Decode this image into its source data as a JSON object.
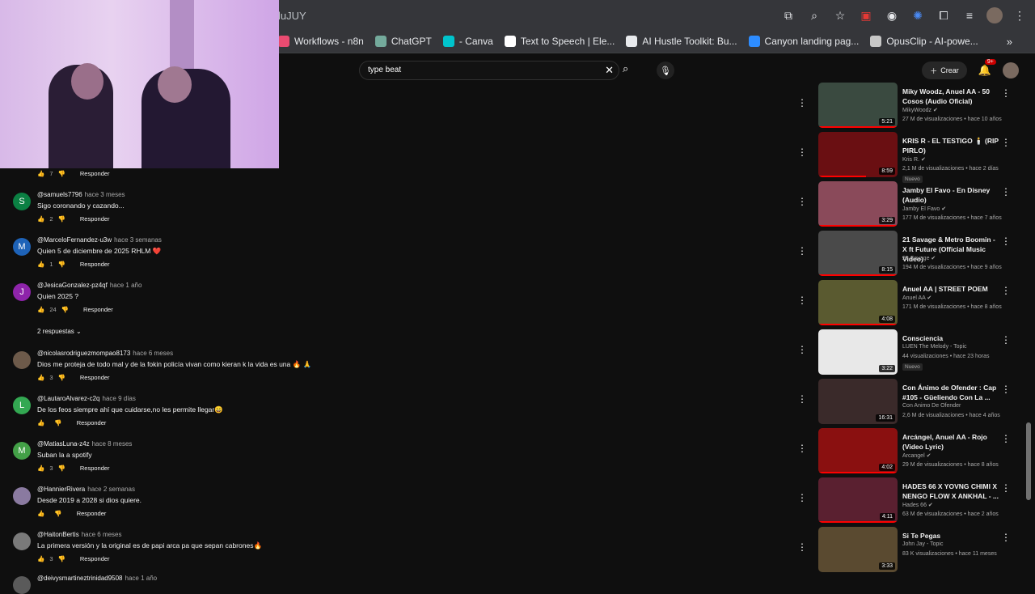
{
  "browser": {
    "url_fragment": "luJUY",
    "icons": [
      "screen-share-icon",
      "zoom-icon",
      "star-icon",
      "pdf-ext-icon",
      "grammarly-ext-icon",
      "ext-icon",
      "puzzle-icon",
      "media-icon",
      "profile-icon"
    ]
  },
  "bookmarks": [
    {
      "label": "Workflows - n8n",
      "color": "#ea4b71"
    },
    {
      "label": "ChatGPT",
      "color": "#74aa9c"
    },
    {
      "label": "- Canva",
      "color": "#00c4cc"
    },
    {
      "label": "Text to Speech | Ele...",
      "color": "#ffffff"
    },
    {
      "label": "AI Hustle Toolkit: Bu...",
      "color": "#e8eaed"
    },
    {
      "label": "Canyon landing pag...",
      "color": "#2d8cff"
    },
    {
      "label": "OpusClip - AI-powe...",
      "color": "#c7c7c7"
    }
  ],
  "bookmarks_more": "»",
  "search": {
    "query": "type beat"
  },
  "header": {
    "create_label": "Crear",
    "notif_count": "9+"
  },
  "comments": [
    {
      "initial": "",
      "user": "",
      "time": "",
      "text": "",
      "likes": "7",
      "reply": "Responder",
      "color": "#555"
    },
    {
      "initial": "S",
      "user": "@samuels7796",
      "time": "hace 3 meses",
      "text": "Sigo coronando y cazando...",
      "likes": "2",
      "reply": "Responder",
      "color": "#0b8043"
    },
    {
      "initial": "M",
      "user": "@MarceloFernandez-u3w",
      "time": "hace 3 semanas",
      "text": "Quien 5 de diciembre de 2025 RHLM ❤️",
      "likes": "1",
      "reply": "Responder",
      "color": "#1e63b8"
    },
    {
      "initial": "J",
      "user": "@JesicaGonzalez-pz4qf",
      "time": "hace 1 año",
      "text": "Quien 2025 ?",
      "likes": "24",
      "reply": "Responder",
      "color": "#8e24aa"
    },
    {
      "initial": "",
      "user": "@nicolasrodriguezmompao8173",
      "time": "hace 6 meses",
      "text": "Dios me proteja de todo mal y de la fokin policía vivan como kieran k la vida es una 🔥 🙏",
      "likes": "3",
      "reply": "Responder",
      "color": "#6d5a4a"
    },
    {
      "initial": "L",
      "user": "@LautaroAlvarez-c2q",
      "time": "hace 9 días",
      "text": "De los feos siempre ahí que cuidarse,no les permite llegar😄",
      "likes": "",
      "reply": "Responder",
      "color": "#33a852"
    },
    {
      "initial": "M",
      "user": "@MatiasLuna-z4z",
      "time": "hace 8 meses",
      "text": "Suban la a spotify",
      "likes": "3",
      "reply": "Responder",
      "color": "#43a047"
    },
    {
      "initial": "",
      "user": "@HannierRivera",
      "time": "hace 2 semanas",
      "text": "Desde 2019 a 2028 si dios quiere.",
      "likes": "",
      "reply": "Responder",
      "color": "#8a7aa0"
    },
    {
      "initial": "",
      "user": "@HaitonBertis",
      "time": "hace 6 meses",
      "text": "La primera versión y la original es de papi arca pa que sepan cabrones🔥",
      "likes": "3",
      "reply": "Responder",
      "color": "#7a7a7a"
    },
    {
      "initial": "",
      "user": "@deivysmartineztrinidad9508",
      "time": "hace 1 año",
      "text": "",
      "likes": "",
      "reply": "",
      "color": "#5a5a5a"
    }
  ],
  "replies_toggle": "2 respuestas",
  "related": [
    {
      "title": "Miky Woodz, Anuel AA - 50 Cosos (Audio Oficial)",
      "channel": "MikyWoodz ✔",
      "meta": "27 M de visualizaciones • hace 10 años",
      "duration": "5:21",
      "badge": "",
      "bg": "#3a4a40",
      "progress": 1.0
    },
    {
      "title": "KRIS R - EL TESTIGO 🕯️ (RIP PIRLO)",
      "channel": "Kris R. ✔",
      "meta": "2,1 M de visualizaciones • hace 2 días",
      "duration": "8:59",
      "badge": "Nuevo",
      "bg": "#6a0f12",
      "progress": 0.6
    },
    {
      "title": "Jamby El Favo - En Disney (Audio)",
      "channel": "Jamby El Favo ✔",
      "meta": "177 M de visualizaciones • hace 7 años",
      "duration": "3:29",
      "badge": "",
      "bg": "#8a4a5a",
      "progress": 1.0
    },
    {
      "title": "21 Savage & Metro Boomin - X ft Future (Official Music Video)",
      "channel": "21 Savage ✔",
      "meta": "194 M de visualizaciones • hace 9 años",
      "duration": "8:15",
      "badge": "",
      "bg": "#4a4a4a",
      "progress": 1.0
    },
    {
      "title": "Anuel AA | STREET POEM",
      "channel": "Anuel AA ✔",
      "meta": "171 M de visualizaciones • hace 8 años",
      "duration": "4:08",
      "badge": "",
      "bg": "#5a5a30",
      "progress": 1.0
    },
    {
      "title": "Consciencia",
      "channel": "LUEN The Melody - Topic",
      "meta": "44 visualizaciones • hace 23 horas",
      "duration": "3:22",
      "badge": "Nuevo",
      "bg": "#e8e8e8",
      "progress": 0
    },
    {
      "title": "Con Ánimo de Ofender : Cap #105 - Güeliendo Con La ...",
      "channel": "Con Animo De Ofender",
      "meta": "2,6 M de visualizaciones • hace 4 años",
      "duration": "16:31",
      "badge": "",
      "bg": "#3a2a2a",
      "progress": 0
    },
    {
      "title": "Arcángel, Anuel AA - Rojo (Video Lyric)",
      "channel": "Arcangel ✔",
      "meta": "29 M de visualizaciones • hace 8 años",
      "duration": "4:02",
      "badge": "",
      "bg": "#8a1010",
      "progress": 1.0
    },
    {
      "title": "HADES 66 X YOVNG CHIMI X NENGO FLOW X ANKHAL - ...",
      "channel": "Hades 66 ✔",
      "meta": "63 M de visualizaciones • hace 2 años",
      "duration": "4:11",
      "badge": "",
      "bg": "#5a2030",
      "progress": 1.0
    },
    {
      "title": "Si Te Pegas",
      "channel": "John Jay - Topic",
      "meta": "83 K visualizaciones • hace 11 meses",
      "duration": "3:33",
      "badge": "",
      "bg": "#5a4a30",
      "progress": 0
    }
  ]
}
